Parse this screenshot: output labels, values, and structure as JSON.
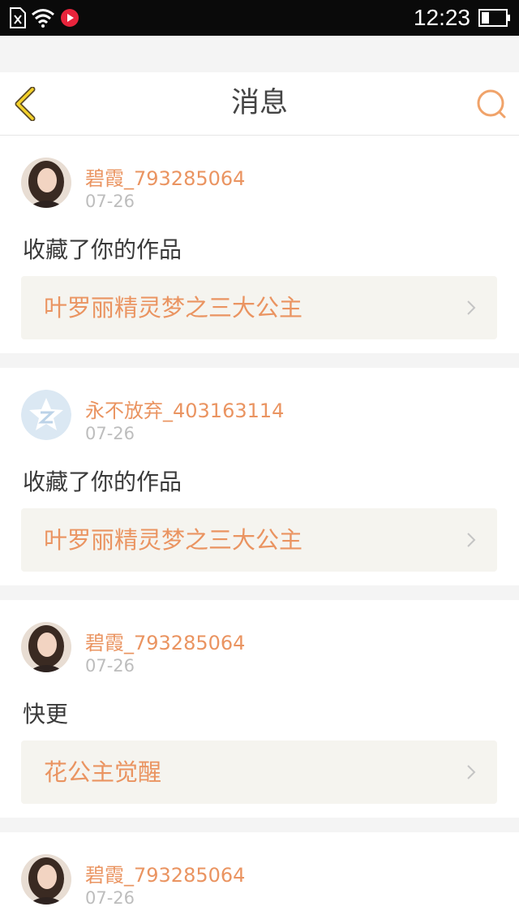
{
  "status_bar": {
    "time": "12:23"
  },
  "header": {
    "title": "消息"
  },
  "messages": [
    {
      "user": "碧霞_793285064",
      "date": "07-26",
      "action": "收藏了你的作品",
      "work_title": "叶罗丽精灵梦之三大公主",
      "avatar": "photo-avatar"
    },
    {
      "user": "永不放弃_403163114",
      "date": "07-26",
      "action": "收藏了你的作品",
      "work_title": "叶罗丽精灵梦之三大公主",
      "avatar": "default-z-avatar"
    },
    {
      "user": "碧霞_793285064",
      "date": "07-26",
      "action": "快更",
      "work_title": "花公主觉醒",
      "avatar": "photo-avatar"
    },
    {
      "user": "碧霞_793285064",
      "date": "07-26",
      "avatar": "photo-avatar"
    }
  ],
  "colors": {
    "accent": "#ea9461",
    "link_bg": "#f5f4ef",
    "date": "#bdbdbd"
  }
}
